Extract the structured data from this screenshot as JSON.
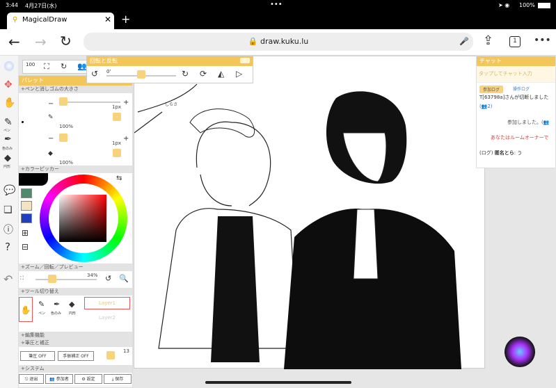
{
  "status": {
    "time": "3:44",
    "date": "4月27日(水)",
    "battery": "100%"
  },
  "browser": {
    "tab_title": "MagicalDraw",
    "url": "draw.kuku.lu",
    "tab_count": "1"
  },
  "rotate_panel": {
    "title": "回転と反転",
    "angle": "0'"
  },
  "palette": {
    "title": "パレット",
    "pen_section": "+ペンと消しゴムの大きさ",
    "size1": "1px",
    "opacity1": "100%",
    "size2": "1px",
    "opacity2": "100%",
    "color_section": "+カラーピッカー",
    "zoom_section": "+ズーム／回転／プレビュー",
    "zoom_value": "34%",
    "tool_section": "+ツール切り替え",
    "tool_pen": "ペン",
    "tool_color": "色のみ",
    "tool_circle": "円形",
    "layer1": "Layer1",
    "layer2": "Layer2",
    "edit_section": "+編集機能",
    "pressure_section": "+筆圧と補正",
    "pressure_btn": "筆圧 OFF",
    "correction_btn": "手振補正 OFF",
    "correction_value": "13",
    "system_section": "+システム",
    "exit": "退出",
    "participants": "参加者",
    "settings": "設定",
    "save": "保存",
    "zoom_num": "100"
  },
  "left_tools": {
    "pen_label": "ペン",
    "color_label": "色のみ",
    "circle_label": "円形"
  },
  "chat": {
    "title": "チャット",
    "placeholder": "タップしてチャット入力",
    "tab_join": "参加ログ",
    "tab_op": "操作ログ",
    "log1": "T[63798a]さんが切断しました",
    "log1_count": "(👥2)",
    "log2": "参加しました。(👥",
    "log3": "あなたはルームオーナーで",
    "log4_prefix": "(ログ)",
    "log4_name": "匿名とら",
    "log4_text": ": う"
  },
  "canvas": {
    "sticker": "しらさ"
  },
  "colors": {
    "accent": "#f3c65a",
    "swatch1": "#4f8a6c",
    "swatch2": "#f3e2c3",
    "swatch3": "#1f3fbf"
  }
}
